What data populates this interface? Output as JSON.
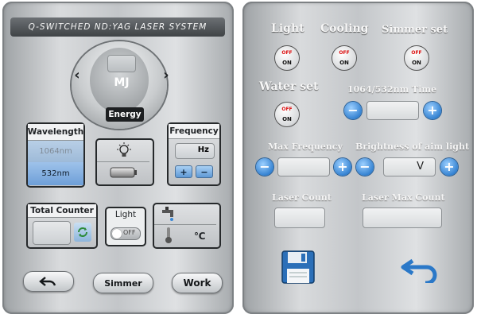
{
  "left": {
    "title": "Q-SWITCHED ND:YAG LASER SYSTEM",
    "energy": {
      "unit": "MJ",
      "label": "Energy",
      "left_arrow": "‹",
      "right_arrow": "›"
    },
    "wavelength": {
      "label": "Wavelength",
      "options": [
        "1064nm",
        "532nm"
      ],
      "selected": "532nm"
    },
    "frequency": {
      "label": "Frequency",
      "unit": "Hz",
      "plus": "+",
      "minus": "−"
    },
    "total_counter": {
      "label": "Total Counter"
    },
    "light_toggle": {
      "label": "Light",
      "state": "OFF"
    },
    "cooling_unit": "℃",
    "buttons": {
      "simmer": "Simmer",
      "work": "Work"
    }
  },
  "right": {
    "switches": [
      {
        "label": "Light",
        "off": "OFF",
        "on": "ON"
      },
      {
        "label": "Cooling",
        "off": "OFF",
        "on": "ON"
      },
      {
        "label": "Simmer set",
        "off": "OFF",
        "on": "ON"
      },
      {
        "label": "Water set",
        "off": "OFF",
        "on": "ON"
      }
    ],
    "time": {
      "label": "1064/532nm Time"
    },
    "max_frequency": {
      "label": "Max Frequency"
    },
    "brightness": {
      "label": "Brightness of aim light",
      "unit": "V"
    },
    "laser_count": {
      "label": "Laser Count"
    },
    "laser_max_count": {
      "label": "Laser Max Count"
    },
    "plus": "+",
    "minus": "−"
  },
  "colors": {
    "accent_blue": "#2f7ecf",
    "off_red": "#dd1111",
    "panel_silver": "#c3c6c9"
  },
  "icons": [
    "chevron-left-icon",
    "chevron-right-icon",
    "lightbulb-icon",
    "battery-icon",
    "refresh-icon",
    "faucet-icon",
    "thermometer-icon",
    "undo-icon",
    "floppy-disk-icon",
    "return-icon"
  ]
}
